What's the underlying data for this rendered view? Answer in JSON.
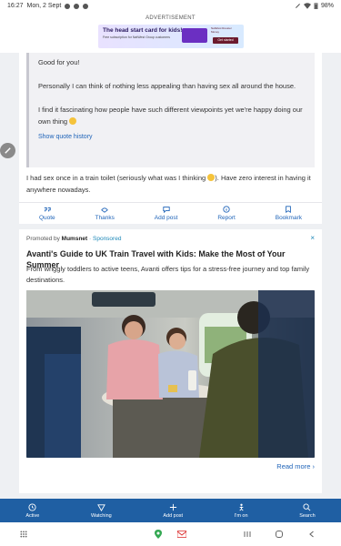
{
  "status": {
    "time": "16:27",
    "date": "Mon, 2 Sept",
    "battery": "98%"
  },
  "ad": {
    "label": "ADVERTISEMENT",
    "headline": "The head start card for kids!",
    "sub": "Free subscription for NatWest Group customers",
    "brand": "NatWest Rooster Money",
    "cta": "Get started"
  },
  "post": {
    "quote_lines": [
      "Good for you!",
      "Personally I can think of nothing less appealing than having sex all around the house.",
      "I find it fascinating how people have such different viewpoints yet we're happy doing our own thing"
    ],
    "show_quote": "Show quote history",
    "reply_part1": "I had sex once in a train toilet (seriously what was I thinking",
    "reply_part2": "). Have zero interest in having it anywhere nowadays."
  },
  "actions": [
    "Quote",
    "Thanks",
    "Add post",
    "Report",
    "Bookmark"
  ],
  "sponsored": {
    "promoted_by": "Promoted by",
    "brand": "Mumsnet",
    "separator": "·",
    "sponsored_label": "Sponsored",
    "close": "×",
    "title": "Avanti's Guide to UK Train Travel with Kids: Make the Most of Your Summer",
    "desc": "From wriggly toddlers to active teens, Avanti offers tips for a stress-free journey and top family destinations.",
    "read_more": "Read more",
    "read_more_chevron": "›"
  },
  "bottom_nav": [
    "Active",
    "Watching",
    "Add post",
    "I'm on",
    "Search"
  ],
  "colors": {
    "nav_bg": "#1f5fa3",
    "link": "#1e63b8",
    "sponsored": "#1e88b8"
  },
  "icons": [
    "quote-icon",
    "thanks-icon",
    "comment-icon",
    "info-icon",
    "bookmark-icon",
    "clock-icon",
    "watch-icon",
    "plus-icon",
    "walk-icon",
    "search-icon",
    "pencil-icon"
  ]
}
